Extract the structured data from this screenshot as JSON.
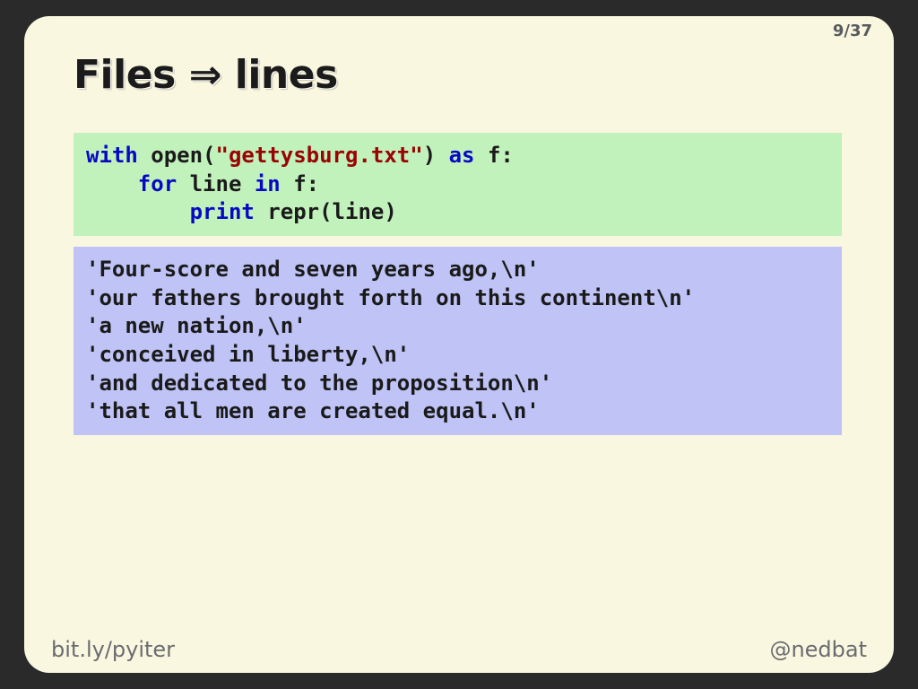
{
  "page": {
    "current": 9,
    "total": 37,
    "display": "9/37"
  },
  "title": "Files ⇒ lines",
  "code": {
    "tokens": [
      {
        "t": "with ",
        "c": "kw"
      },
      {
        "t": "open(",
        "c": ""
      },
      {
        "t": "\"gettysburg.txt\"",
        "c": "str"
      },
      {
        "t": ") ",
        "c": ""
      },
      {
        "t": "as ",
        "c": "kw"
      },
      {
        "t": "f:",
        "c": ""
      },
      {
        "t": "\n",
        "c": ""
      },
      {
        "t": "    ",
        "c": ""
      },
      {
        "t": "for ",
        "c": "kw"
      },
      {
        "t": "line ",
        "c": ""
      },
      {
        "t": "in ",
        "c": "kw"
      },
      {
        "t": "f:",
        "c": ""
      },
      {
        "t": "\n",
        "c": ""
      },
      {
        "t": "        ",
        "c": ""
      },
      {
        "t": "print ",
        "c": "kw"
      },
      {
        "t": "repr(line)",
        "c": ""
      }
    ]
  },
  "output_lines": [
    "'Four-score and seven years ago,\\n'",
    "'our fathers brought forth on this continent\\n'",
    "'a new nation,\\n'",
    "'conceived in liberty,\\n'",
    "'and dedicated to the proposition\\n'",
    "'that all men are created equal.\\n'"
  ],
  "footer": {
    "left": "bit.ly/pyiter",
    "right": "@nedbat"
  }
}
